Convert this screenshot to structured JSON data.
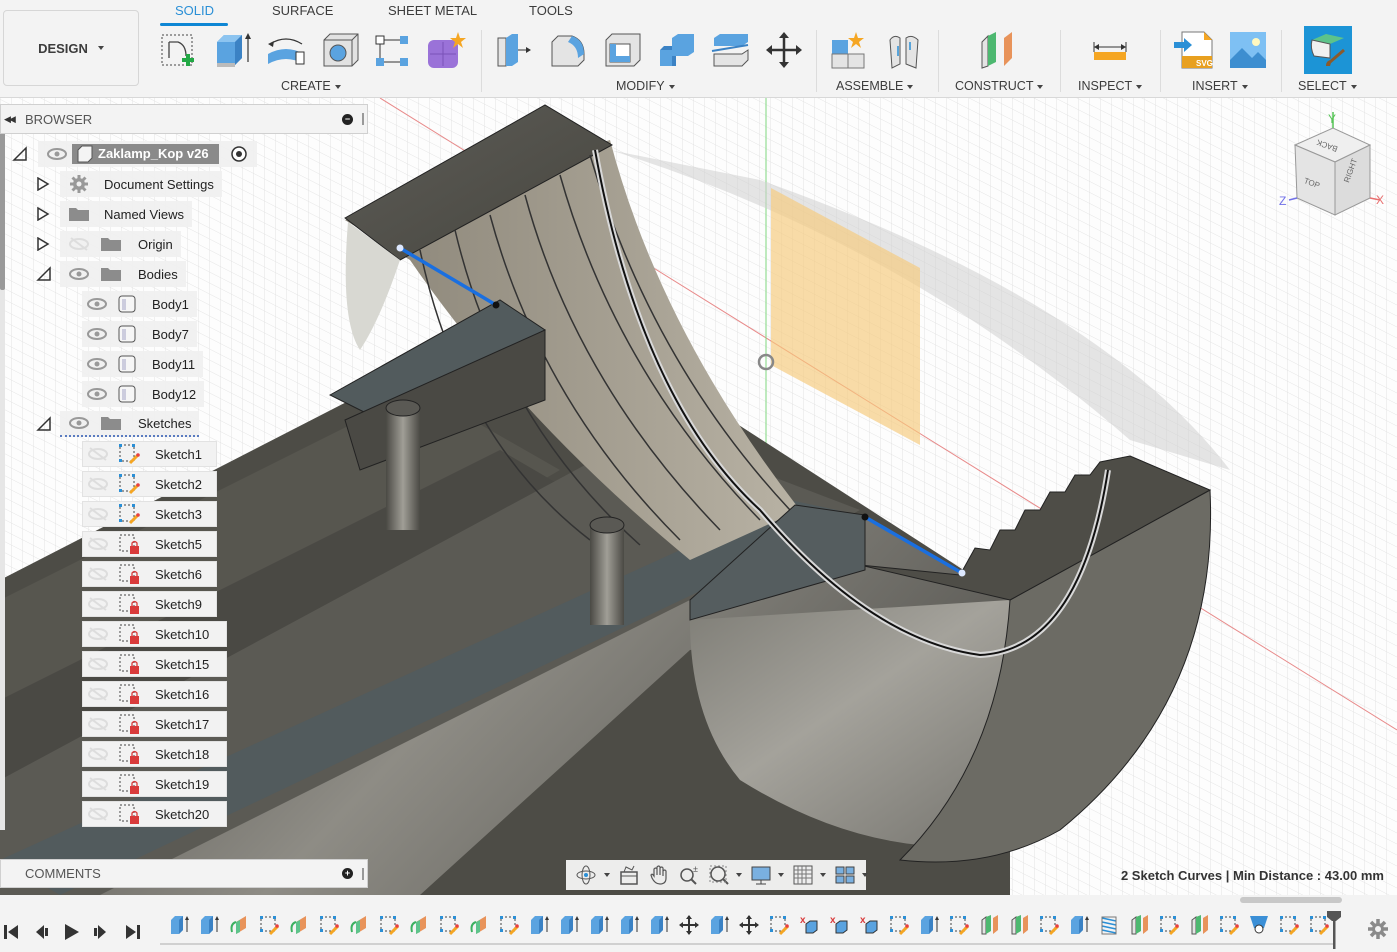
{
  "app": {
    "workspace_button": "DESIGN",
    "tabs": [
      {
        "label": "SOLID",
        "active": true
      },
      {
        "label": "SURFACE",
        "active": false
      },
      {
        "label": "SHEET METAL",
        "active": false
      },
      {
        "label": "TOOLS",
        "active": false
      }
    ],
    "groups": {
      "create": "CREATE",
      "modify": "MODIFY",
      "assemble": "ASSEMBLE",
      "construct": "CONSTRUCT",
      "inspect": "INSPECT",
      "insert": "INSERT",
      "select": "SELECT"
    },
    "tools": {
      "create": [
        "create-sketch-icon",
        "extrude-icon",
        "revolve-icon",
        "hole-icon",
        "pattern-icon",
        "create-form-icon"
      ],
      "modify": [
        "press-pull-icon",
        "fillet-icon",
        "shell-icon",
        "combine-icon",
        "split-body-icon",
        "move-icon"
      ],
      "assemble": [
        "new-component-icon",
        "joint-icon"
      ],
      "construct": [
        "offset-plane-icon"
      ],
      "inspect": [
        "measure-icon"
      ],
      "insert": [
        "insert-svg-icon",
        "insert-canvas-icon"
      ],
      "select": [
        "select-icon"
      ]
    }
  },
  "browser": {
    "title": "BROWSER",
    "root": "Zaklamp_Kop v26",
    "folders": [
      {
        "label": "Document Settings",
        "icon": "gear-icon"
      },
      {
        "label": "Named Views",
        "icon": "folder-icon"
      },
      {
        "label": "Origin",
        "icon": "folder-icon"
      },
      {
        "label": "Bodies",
        "icon": "folder-icon"
      }
    ],
    "bodies": [
      "Body1",
      "Body7",
      "Body11",
      "Body12"
    ],
    "sketches_label": "Sketches",
    "sketches": [
      {
        "label": "Sketch1",
        "locked": false
      },
      {
        "label": "Sketch2",
        "locked": false
      },
      {
        "label": "Sketch3",
        "locked": false
      },
      {
        "label": "Sketch5",
        "locked": true
      },
      {
        "label": "Sketch6",
        "locked": true
      },
      {
        "label": "Sketch9",
        "locked": true
      },
      {
        "label": "Sketch10",
        "locked": true
      },
      {
        "label": "Sketch15",
        "locked": true
      },
      {
        "label": "Sketch16",
        "locked": true
      },
      {
        "label": "Sketch17",
        "locked": true
      },
      {
        "label": "Sketch18",
        "locked": true
      },
      {
        "label": "Sketch19",
        "locked": true
      },
      {
        "label": "Sketch20",
        "locked": true
      }
    ]
  },
  "comments": {
    "title": "COMMENTS"
  },
  "viewcube": {
    "faces": [
      "TOP",
      "BACK",
      "RIGHT"
    ],
    "axes": [
      "X",
      "Y",
      "Z"
    ]
  },
  "status": {
    "measure": "2 Sketch Curves | Min Distance : 43.00 mm"
  },
  "navbar": [
    "orbit-icon",
    "look-at-icon",
    "pan-icon",
    "zoom-icon",
    "fit-icon",
    "display-settings-icon",
    "grid-icon",
    "viewports-icon"
  ],
  "timeline": {
    "controls": [
      "first",
      "previous",
      "play",
      "next",
      "last"
    ],
    "items": [
      "extrude",
      "extrude",
      "plane",
      "sketch",
      "plane",
      "sketch",
      "plane",
      "sketch",
      "plane",
      "sketch",
      "plane",
      "sketch",
      "extrude",
      "extrude",
      "extrude",
      "extrude",
      "extrude",
      "move",
      "extrude",
      "move",
      "sketch",
      "delete",
      "delete",
      "delete",
      "sketch",
      "extrude",
      "sketch",
      "plane-green",
      "plane-orange",
      "sketch",
      "extrude",
      "thread",
      "plane-green",
      "sketch",
      "plane-orange",
      "sketch",
      "hole",
      "sketch",
      "sketch"
    ]
  },
  "colors": {
    "accent": "#0e86d4",
    "sketch_line": "#1a6fe0",
    "plane": "#f6c97a"
  }
}
